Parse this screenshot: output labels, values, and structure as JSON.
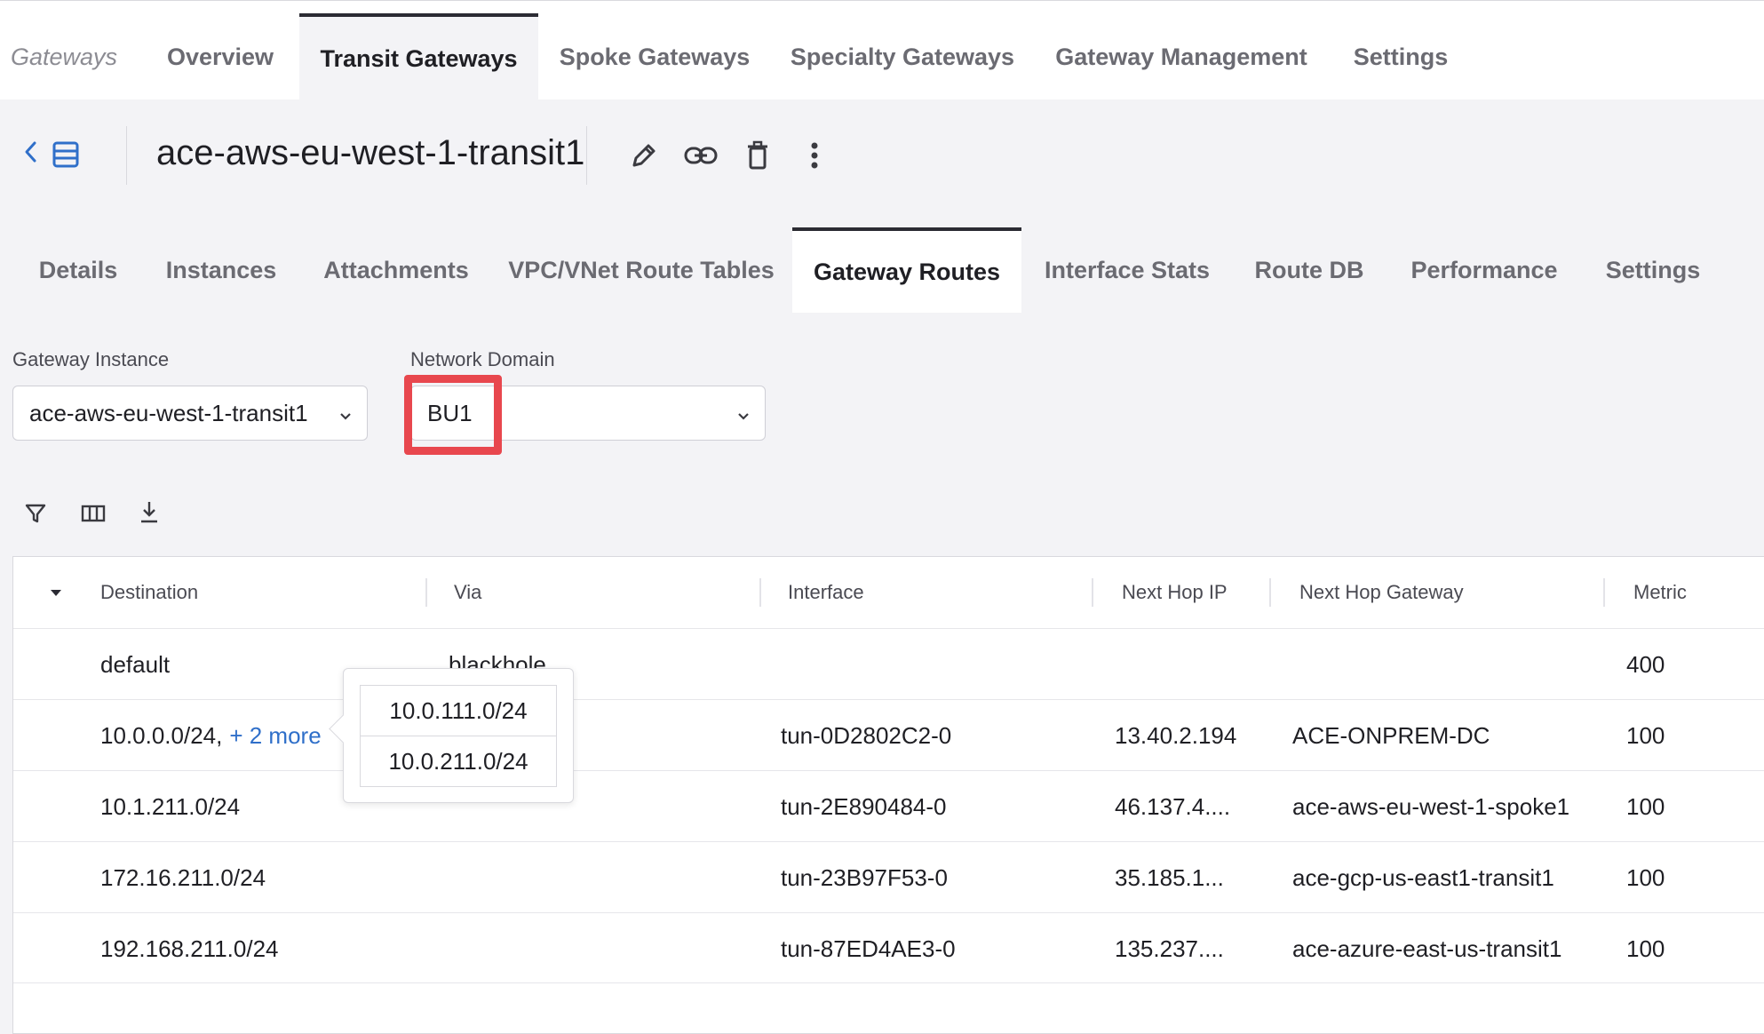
{
  "top_nav": {
    "section_label": "Gateways",
    "tabs": [
      {
        "label": "Overview"
      },
      {
        "label": "Transit Gateways"
      },
      {
        "label": "Spoke Gateways"
      },
      {
        "label": "Specialty Gateways"
      },
      {
        "label": "Gateway Management"
      },
      {
        "label": "Settings"
      }
    ],
    "active_tab": "Transit Gateways"
  },
  "header": {
    "gateway_name": "ace-aws-eu-west-1-transit1",
    "icons": [
      "back-chevron-icon",
      "list-view-icon",
      "edit-pencil-icon",
      "link-icon",
      "delete-trash-icon",
      "more-vertical-icon"
    ]
  },
  "sub_tabs": {
    "tabs": [
      {
        "label": "Details"
      },
      {
        "label": "Instances"
      },
      {
        "label": "Attachments"
      },
      {
        "label": "VPC/VNet Route Tables"
      },
      {
        "label": "Gateway Routes"
      },
      {
        "label": "Interface Stats"
      },
      {
        "label": "Route DB"
      },
      {
        "label": "Performance"
      },
      {
        "label": "Settings"
      }
    ],
    "active_tab": "Gateway Routes"
  },
  "filters": {
    "gateway_instance": {
      "label": "Gateway Instance",
      "value": "ace-aws-eu-west-1-transit1"
    },
    "network_domain": {
      "label": "Network Domain",
      "value": "BU1"
    },
    "highlight_color": "#e8474e"
  },
  "toolbar": {
    "icons": [
      "filter-icon",
      "columns-icon",
      "download-icon"
    ]
  },
  "table": {
    "columns": [
      "Destination",
      "Via",
      "Interface",
      "Next Hop IP",
      "Next Hop Gateway",
      "Metric"
    ],
    "rows": [
      {
        "destination": "default",
        "more": "",
        "via": "blackhole",
        "interface": "",
        "next_hop_ip": "",
        "next_hop_gateway": "",
        "metric": "400"
      },
      {
        "destination": "10.0.0.0/24,",
        "more": "+ 2 more",
        "via": "",
        "interface": "tun-0D2802C2-0",
        "next_hop_ip": "13.40.2.194",
        "next_hop_gateway": "ACE-ONPREM-DC",
        "metric": "100"
      },
      {
        "destination": "10.1.211.0/24",
        "more": "",
        "via": "",
        "interface": "tun-2E890484-0",
        "next_hop_ip": "46.137.4....",
        "next_hop_gateway": "ace-aws-eu-west-1-spoke1",
        "metric": "100"
      },
      {
        "destination": "172.16.211.0/24",
        "more": "",
        "via": "",
        "interface": "tun-23B97F53-0",
        "next_hop_ip": "35.185.1...",
        "next_hop_gateway": "ace-gcp-us-east1-transit1",
        "metric": "100"
      },
      {
        "destination": "192.168.211.0/24",
        "more": "",
        "via": "",
        "interface": "tun-87ED4AE3-0",
        "next_hop_ip": "135.237....",
        "next_hop_gateway": "ace-azure-east-us-transit1",
        "metric": "100"
      }
    ]
  },
  "popover": {
    "items": [
      "10.0.111.0/24",
      "10.0.211.0/24"
    ]
  }
}
